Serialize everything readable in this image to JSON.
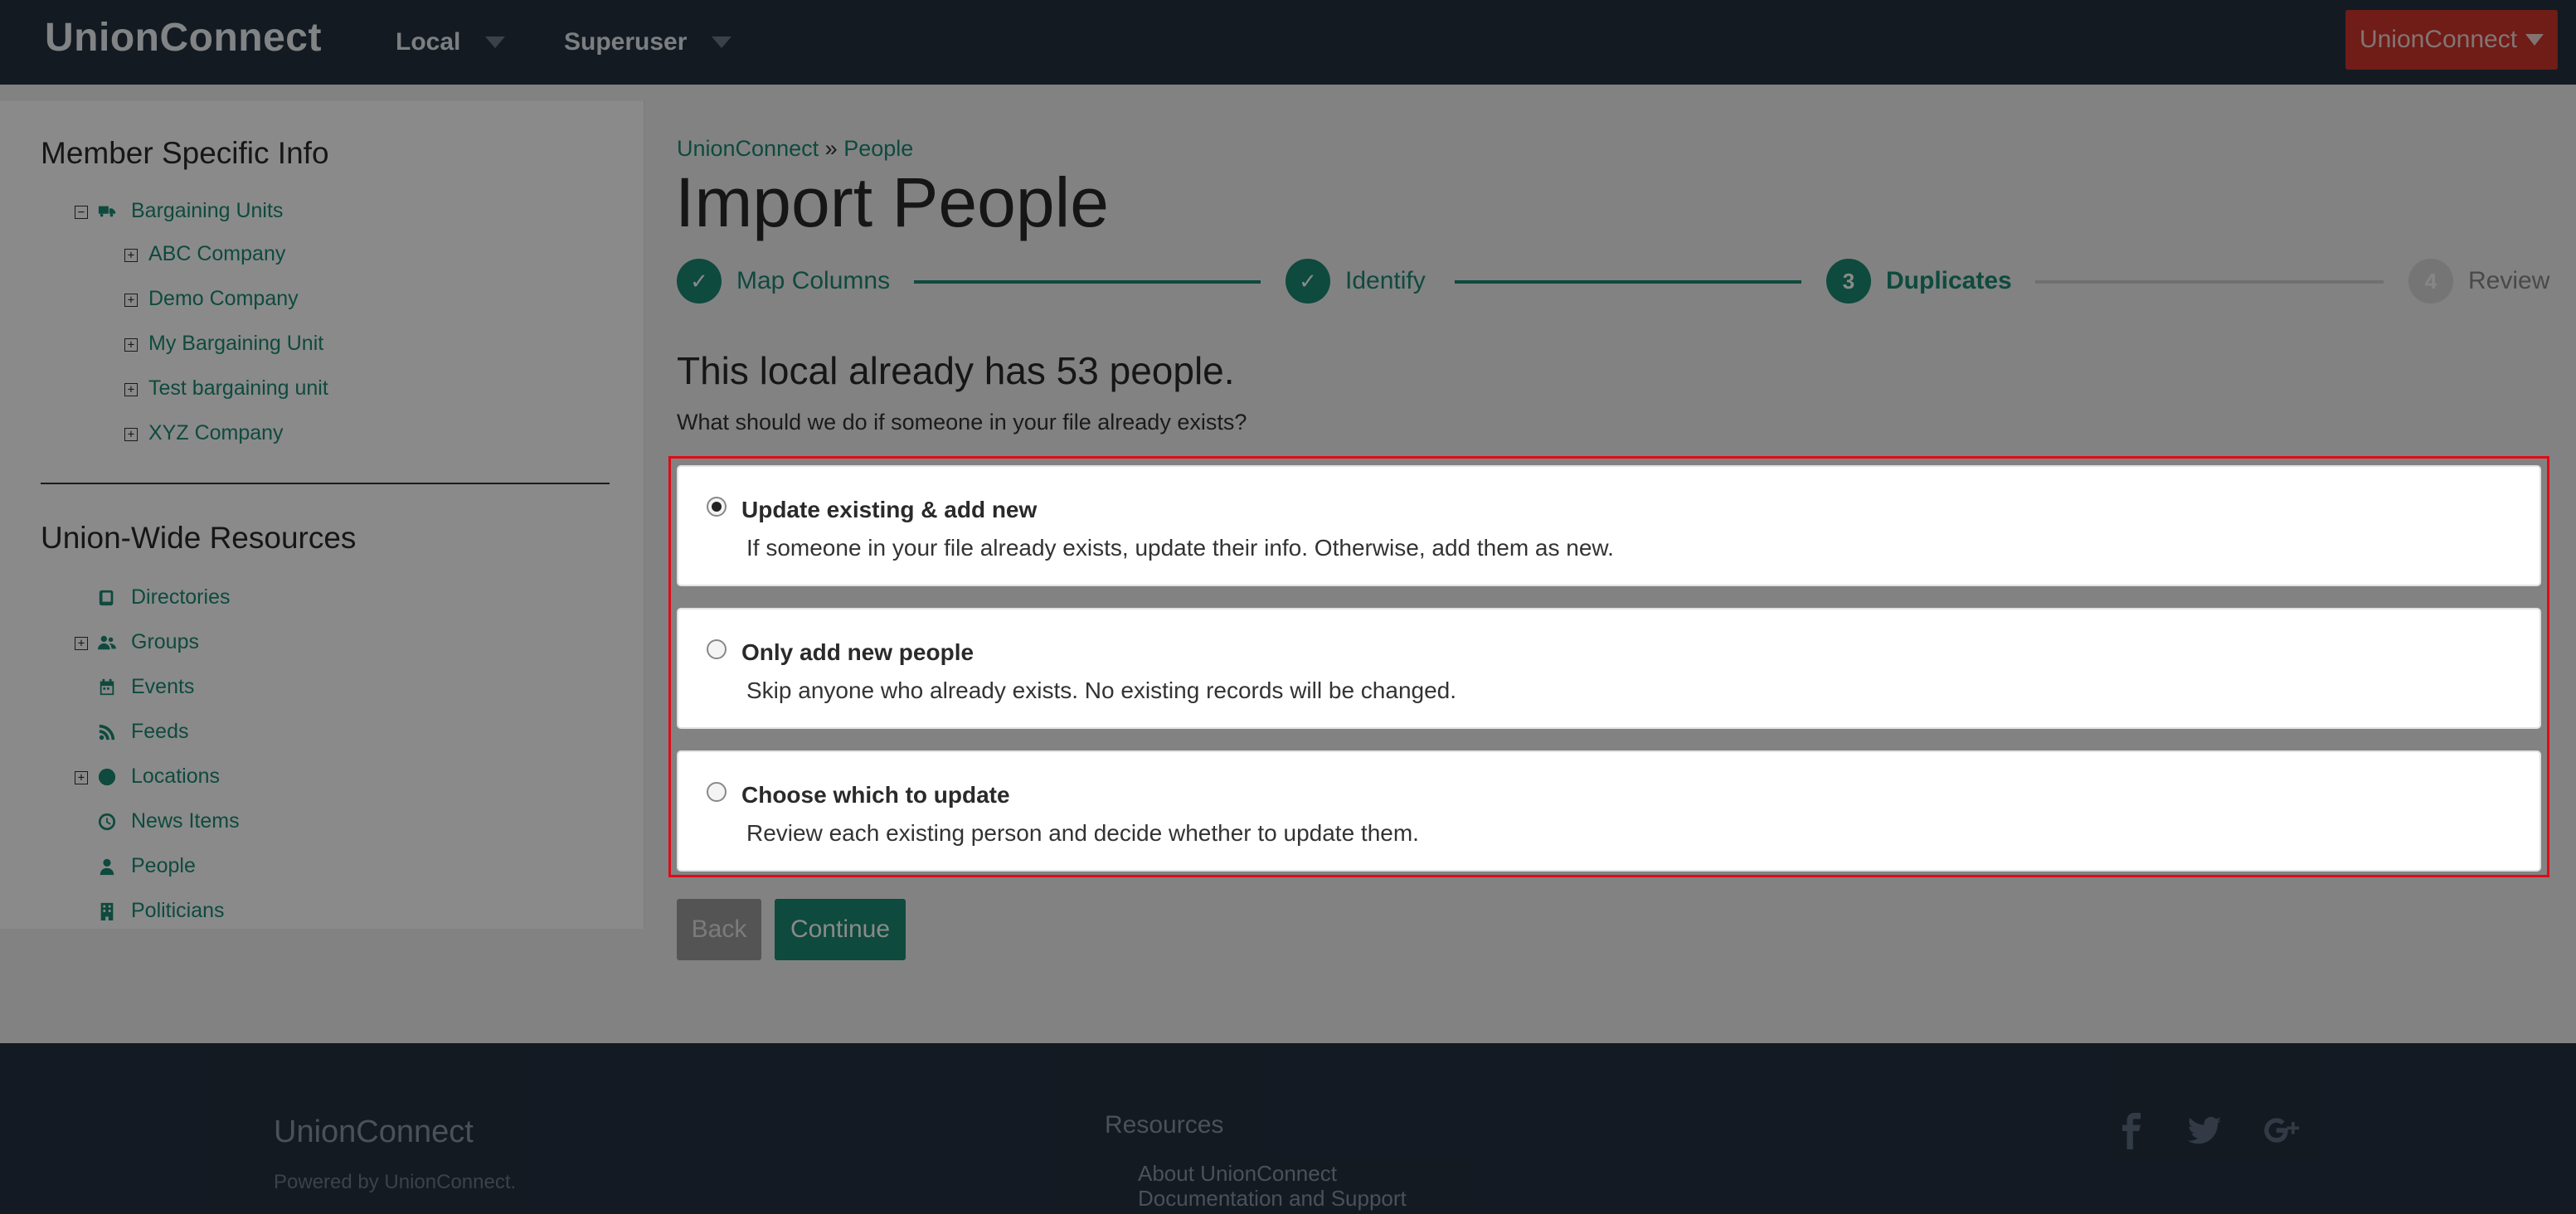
{
  "nav": {
    "brand": "UnionConnect",
    "menus": [
      "Local",
      "Superuser"
    ],
    "account_label": "UnionConnect"
  },
  "sidebar": {
    "member_heading": "Member Specific Info",
    "bargaining_root": "Bargaining Units",
    "bargaining_units": [
      "ABC Company",
      "Demo Company",
      "My Bargaining Unit",
      "Test bargaining unit",
      "XYZ Company"
    ],
    "resources_heading": "Union-Wide Resources",
    "resources": [
      {
        "label": "Directories",
        "icon": "book-icon",
        "expandable": false
      },
      {
        "label": "Groups",
        "icon": "users-icon",
        "expandable": true
      },
      {
        "label": "Events",
        "icon": "calendar-icon",
        "expandable": false
      },
      {
        "label": "Feeds",
        "icon": "rss-icon",
        "expandable": false
      },
      {
        "label": "Locations",
        "icon": "globe-icon",
        "expandable": true
      },
      {
        "label": "News Items",
        "icon": "clock-icon",
        "expandable": false
      },
      {
        "label": "People",
        "icon": "user-icon",
        "expandable": false
      },
      {
        "label": "Politicians",
        "icon": "building-icon",
        "expandable": false
      }
    ]
  },
  "breadcrumb": {
    "root": "UnionConnect",
    "separator": "»",
    "current": "People"
  },
  "page_title": "Import People",
  "steps": [
    {
      "marker": "✓",
      "label": "Map Columns",
      "state": "done"
    },
    {
      "marker": "✓",
      "label": "Identify",
      "state": "done"
    },
    {
      "marker": "3",
      "label": "Duplicates",
      "state": "active"
    },
    {
      "marker": "4",
      "label": "Review",
      "state": "todo"
    }
  ],
  "count_heading": "This local already has 53 people.",
  "question": "What should we do if someone in your file already exists?",
  "options": [
    {
      "title": "Update existing & add new",
      "desc": "If someone in your file already exists, update their info. Otherwise, add them as new.",
      "checked": true
    },
    {
      "title": "Only add new people",
      "desc": "Skip anyone who already exists. No existing records will be changed.",
      "checked": false
    },
    {
      "title": "Choose which to update",
      "desc": "Review each existing person and decide whether to update them.",
      "checked": false
    }
  ],
  "buttons": {
    "back": "Back",
    "continue": "Continue"
  },
  "footer": {
    "brand": "UnionConnect",
    "powered": "Powered by UnionConnect.",
    "resources_heading": "Resources",
    "links": [
      "About UnionConnect",
      "Documentation and Support"
    ],
    "social": [
      "facebook-icon",
      "twitter-icon",
      "google-plus-icon"
    ]
  },
  "colors": {
    "accent": "#1a8a72",
    "nav_bg": "#233040",
    "account_button": "#d0352c",
    "highlight_frame": "#e10a16"
  }
}
